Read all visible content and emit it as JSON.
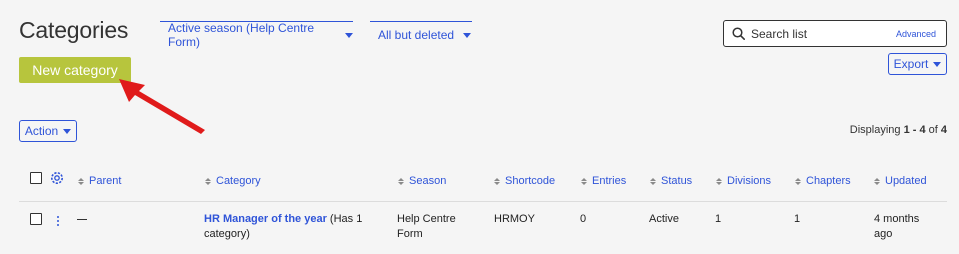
{
  "page": {
    "title": "Categories"
  },
  "filters": {
    "season": "Active season (Help Centre Form)",
    "deleted": "All but deleted"
  },
  "search": {
    "placeholder": "Search list",
    "advanced": "Advanced"
  },
  "toolbar": {
    "new_category": "New category",
    "export": "Export",
    "action": "Action"
  },
  "pagination": {
    "prefix": "Displaying ",
    "range": "1 - 4",
    "of": " of ",
    "total": "4"
  },
  "table": {
    "columns": [
      "Parent",
      "Category",
      "Season",
      "Shortcode",
      "Entries",
      "Status",
      "Divisions",
      "Chapters",
      "Updated"
    ],
    "rows": [
      {
        "parent": "—",
        "category_name": "HR Manager of the year",
        "category_suffix_1": " (Has 1",
        "category_suffix_2": "category)",
        "season_1": "Help Centre",
        "season_2": "Form",
        "shortcode": "HRMOY",
        "entries": "0",
        "status": "Active",
        "divisions": "1",
        "chapters": "1",
        "updated_1": "4 months",
        "updated_2": "ago"
      }
    ]
  },
  "colors": {
    "accent": "#2f54d8",
    "new_button": "#b7c53d",
    "annotation_arrow": "#e01b1b"
  },
  "icons": {
    "search": "search-icon",
    "settings": "gear-icon",
    "row_menu": "kebab-menu-icon",
    "annotation": "red-arrow-icon"
  }
}
